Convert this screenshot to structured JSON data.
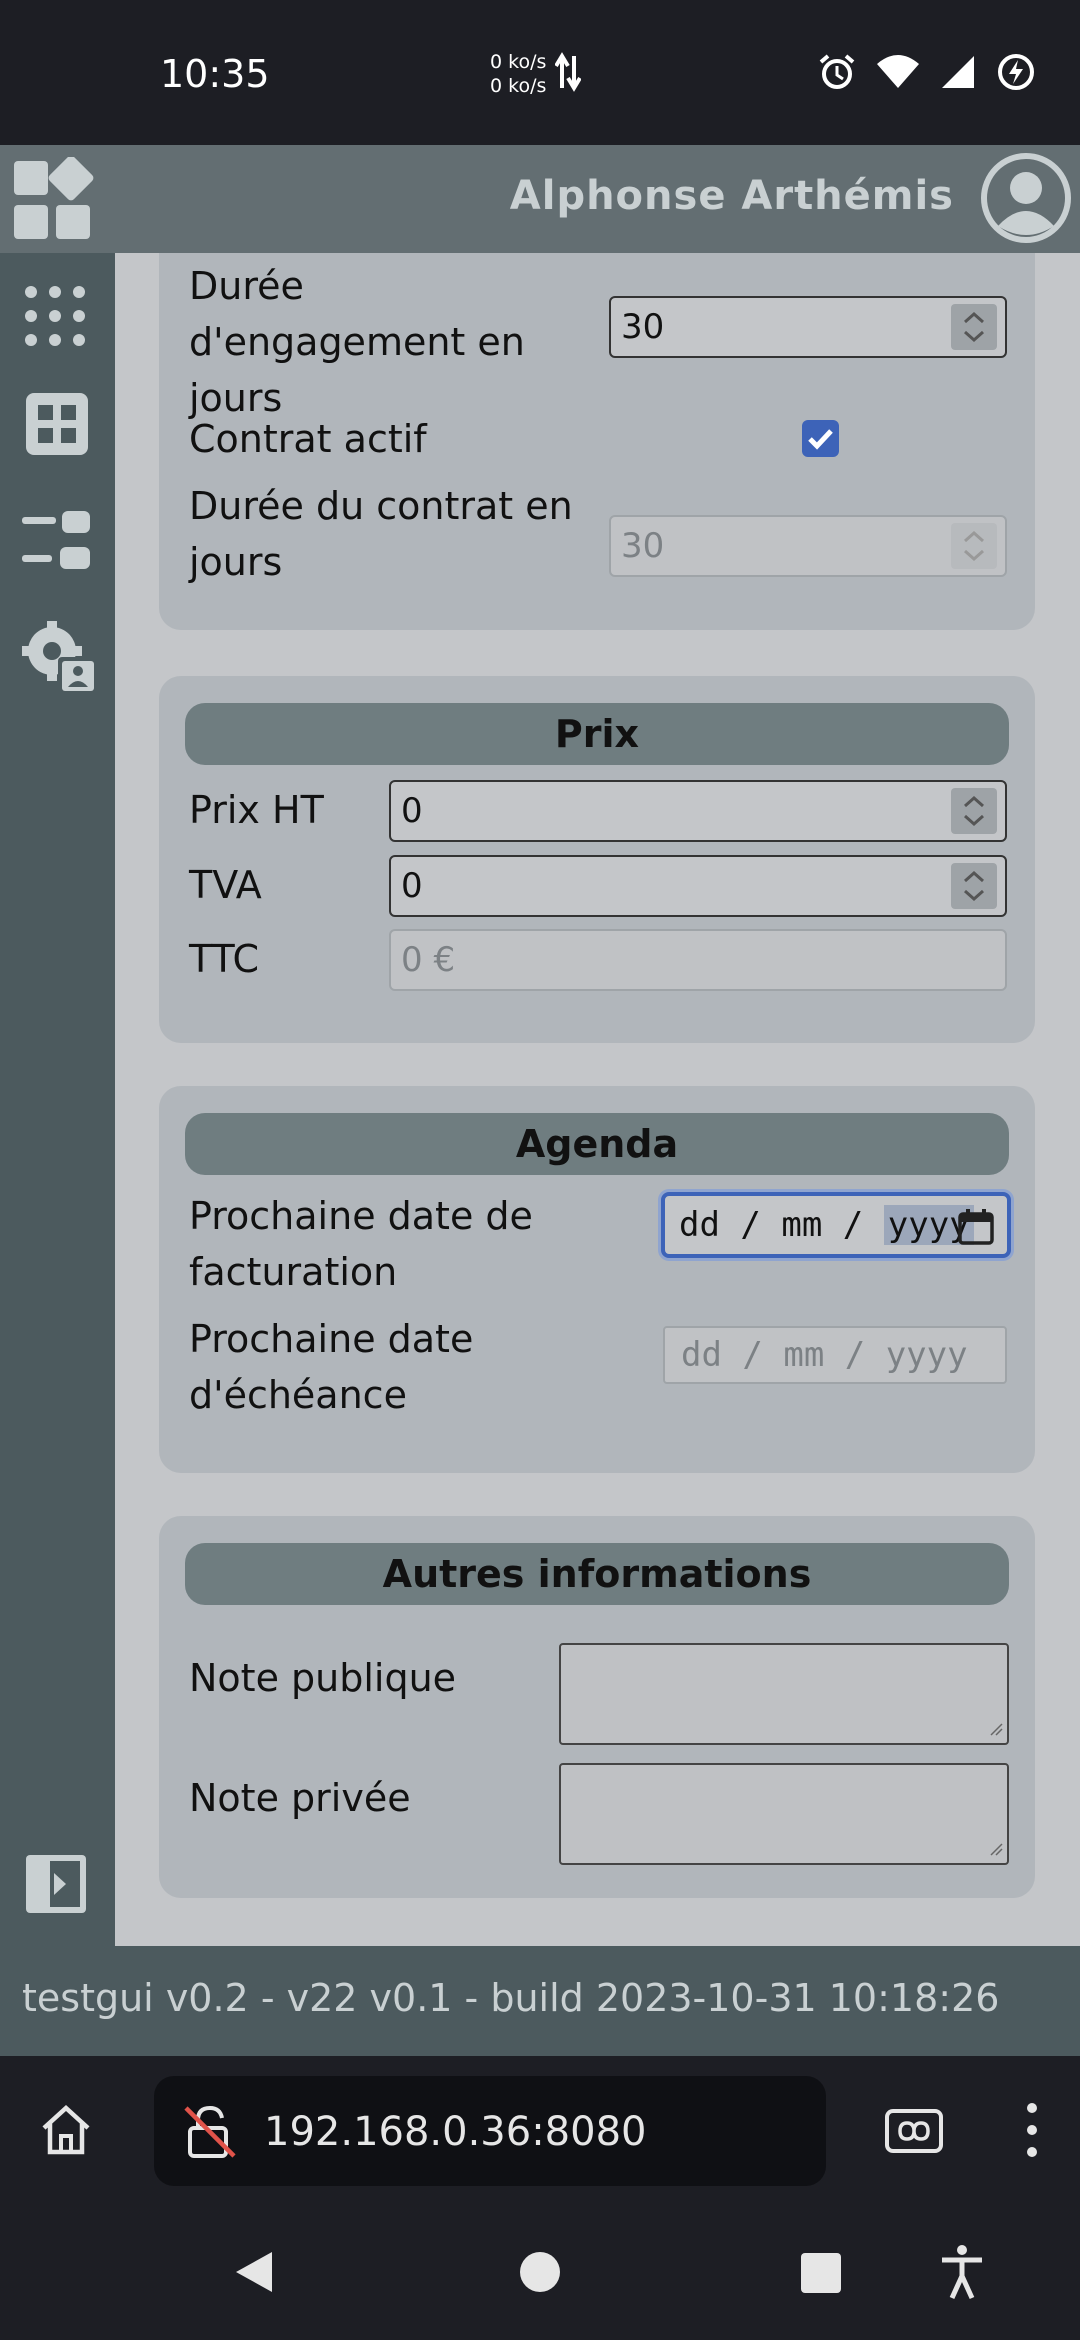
{
  "status_bar": {
    "time": "10:35",
    "net_up": "0 ko/s",
    "net_down": "0 ko/s",
    "icons": [
      "alarm-icon",
      "wifi-icon",
      "signal-icon",
      "battery-saver-icon"
    ]
  },
  "header": {
    "user_name": "Alphonse Arthémis",
    "logo_icon": "apps-logo-icon",
    "avatar_icon": "user-avatar-icon"
  },
  "sidebar": {
    "items": [
      "dots-grid-icon",
      "dashboard-grid-icon",
      "list-toggle-icon",
      "user-settings-icon"
    ],
    "collapse_icon": "sidebar-collapse-icon"
  },
  "contract": {
    "engagement_label": "Durée d'engagement en jours",
    "engagement_label_lines": [
      "Durée",
      "d'engagement en",
      "jours"
    ],
    "engagement_value": "30",
    "active_label": "Contrat actif",
    "active_checked": true,
    "duration_label_lines": [
      "Durée du contrat en",
      "jours"
    ],
    "duration_value": "30"
  },
  "price": {
    "title": "Prix",
    "ht_label": "Prix HT",
    "ht_value": "0",
    "tva_label": "TVA",
    "tva_value": "0",
    "ttc_label": "TTC",
    "ttc_value": "0 €"
  },
  "agenda": {
    "title": "Agenda",
    "billing_label_lines": [
      "Prochaine date de",
      "facturation"
    ],
    "billing_dd": "dd",
    "billing_mm": "mm",
    "billing_yyyy": "yyyy",
    "due_label_lines": [
      "Prochaine date",
      "d'échéance"
    ],
    "due_placeholder": "dd / mm / yyyy"
  },
  "other": {
    "title": "Autres informations",
    "public_note_label": "Note publique",
    "private_note_label": "Note privée"
  },
  "footer": {
    "text": "testgui v0.2 - v22 v0.1 - build 2023-10-31 10:18:26"
  },
  "browser": {
    "url": "192.168.0.36:8080"
  },
  "colors": {
    "header": "#636e72",
    "sidebar": "#4c5a5e",
    "section_title": "#6f7d80",
    "checkbox": "#3d63b8"
  }
}
